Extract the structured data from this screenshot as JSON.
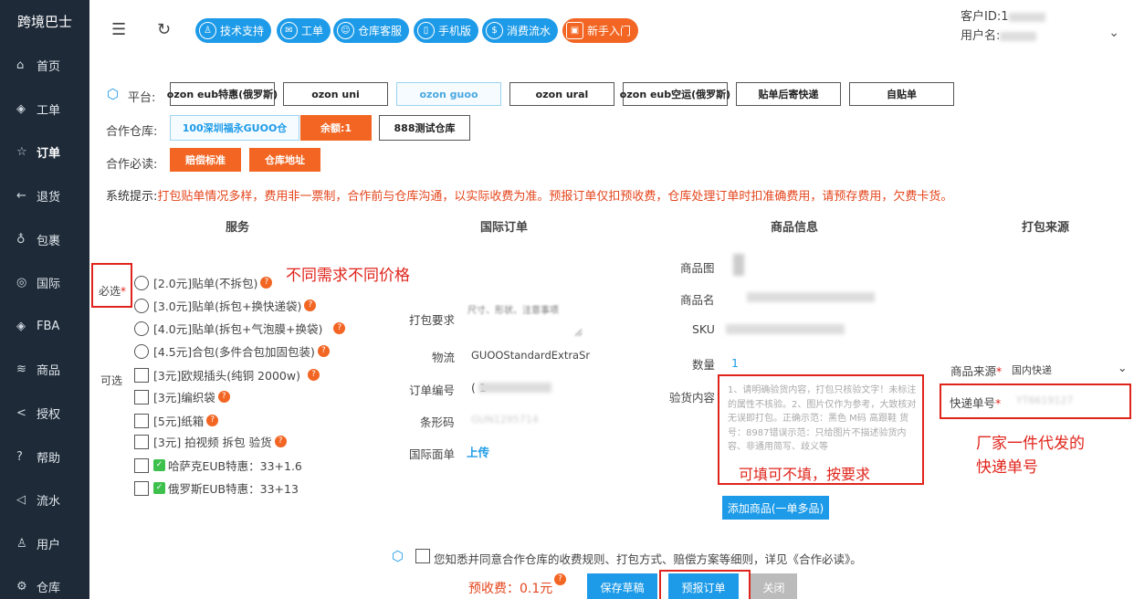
{
  "app": {
    "brand": "跨境巴士"
  },
  "sidebar": {
    "items": [
      {
        "label": "首页",
        "icon": "⌂"
      },
      {
        "label": "工单",
        "icon": "◈"
      },
      {
        "label": "订单",
        "icon": "☆"
      },
      {
        "label": "退货",
        "icon": "←"
      },
      {
        "label": "包裹",
        "icon": "♁"
      },
      {
        "label": "国际",
        "icon": "◎"
      },
      {
        "label": "FBA",
        "icon": "◈"
      },
      {
        "label": "商品",
        "icon": "≋"
      },
      {
        "label": "授权",
        "icon": "<"
      },
      {
        "label": "帮助",
        "icon": "?"
      },
      {
        "label": "流水",
        "icon": "◁"
      },
      {
        "label": "用户",
        "icon": "♙"
      },
      {
        "label": "仓库",
        "icon": "⚙"
      }
    ]
  },
  "topbar": {
    "menu_icon": "☰",
    "refresh_icon": "↻",
    "buttons": [
      {
        "label": "技术支持",
        "icon": "♙"
      },
      {
        "label": "工单",
        "icon": "✉"
      },
      {
        "label": "仓库客服",
        "icon": "☺"
      },
      {
        "label": "手机版",
        "icon": "▯"
      },
      {
        "label": "消费流水",
        "icon": "$"
      },
      {
        "label": "新手入门",
        "icon": "▣"
      }
    ],
    "customer_id_label": "客户ID:1",
    "username_label": "用户名:"
  },
  "form": {
    "platform_label": "平台:",
    "platforms": [
      "ozon eub特惠(俄罗斯)",
      "ozon uni",
      "ozon guoo",
      "ozon ural",
      "ozon eub空运(俄罗斯)",
      "贴单后寄快递",
      "自贴单"
    ],
    "warehouse_label": "合作仓库:",
    "warehouse_selected": "100深圳福永GUOO仓",
    "balance_label": "余额:1",
    "warehouse_other": "888测试仓库",
    "must_read_label": "合作必读:",
    "must_read_buttons": [
      "赔偿标准",
      "仓库地址"
    ],
    "notice_label": "系统提示:",
    "notice_text": "打包贴单情况多样，费用非一票制，合作前与仓库沟通，以实际收费为准。预报订单仅扣预收费，仓库处理订单时扣准确费用，请预存费用，欠费卡货。"
  },
  "columns": {
    "service": "服务",
    "intl": "国际订单",
    "goods": "商品信息",
    "source": "打包来源"
  },
  "service": {
    "required_label": "必选",
    "required_mark": "*",
    "optional_label": "可选",
    "annotation": "不同需求不同价格",
    "required_options": [
      "[2.0元]贴单(不拆包)",
      "[3.0元]贴单(拆包+换快递袋)",
      "[4.0元]贴单(拆包+气泡膜+换袋)",
      "[4.5元]合包(多件合包加固包装)"
    ],
    "optional_options": [
      "[3元]欧规插头(纯铜 2000w)",
      "[3元]编织袋",
      "[5元]纸箱",
      "[3元] 拍视频 拆包 验货"
    ],
    "green_options": [
      "哈萨克EUB特惠：33+1.6",
      "俄罗斯EUB特惠：33+13"
    ]
  },
  "intl": {
    "pack_req_label": "打包要求",
    "pack_req_placeholder": "尺寸、形状、注意事项",
    "logistics_label": "物流",
    "logistics_value": "GUOOStandardExtraSr",
    "order_no_label": "订单编号",
    "order_no_value": "(                1",
    "barcode_label": "条形码",
    "barcode_value": "GUN1295714",
    "face_sheet_label": "国际面单",
    "upload_label": "上传"
  },
  "goods": {
    "image_label": "商品图",
    "name_label": "商品名",
    "sku_label": "SKU",
    "qty_label": "数量",
    "qty_value": "1",
    "inspect_label": "验货内容",
    "inspect_text": "1、请明确验货内容，打包只核验文字！未标注的属性不核验。2、图片仅作为参考，大致核对无误即打包。正确示范：黑色 M码 高跟鞋 货号：8987错误示范：只给图片不描述验货内容、非通用简写、歧义等",
    "inspect_note": "可填可不填，按要求",
    "add_goods": "添加商品(一单多品)"
  },
  "source": {
    "goods_source_label": "商品来源",
    "goods_source_value": "国内快递",
    "tracking_label": "快递单号",
    "tracking_value": "YT6619127",
    "annotation_line1": "厂家一件代发的",
    "annotation_line2": "快递单号",
    "required_mark": "*"
  },
  "footer": {
    "agree_text": "您知悉并同意合作仓库的收费规则、打包方式、赔偿方案等细则，详见《合作必读》。",
    "prefee_label": "预收费：0.1元",
    "save_draft": "保存草稿",
    "submit": "预报订单",
    "close": "关闭"
  }
}
